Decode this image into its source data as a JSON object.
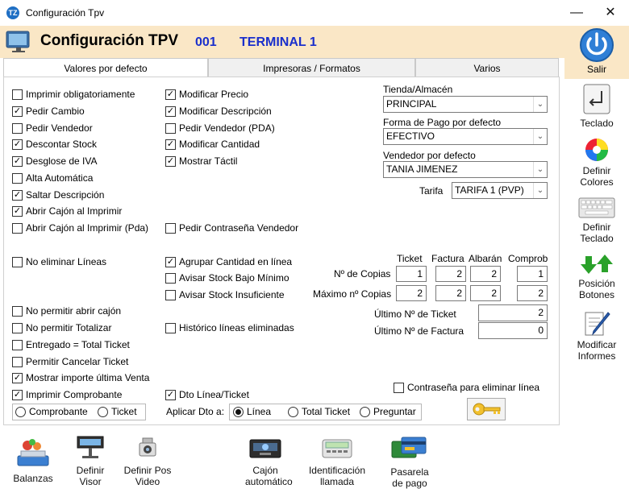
{
  "window": {
    "title": "Configuración Tpv",
    "app_icon_text": "TZ",
    "minimize": "—",
    "close": "✕"
  },
  "header": {
    "title": "Configuración TPV",
    "number": "001",
    "terminal": "TERMINAL 1"
  },
  "tabs": [
    {
      "label": "Valores por defecto",
      "active": true
    },
    {
      "label": "Impresoras / Formatos",
      "active": false
    },
    {
      "label": "Varios",
      "active": false
    }
  ],
  "checkboxes_col1": [
    {
      "label": "Imprimir obligatoriamente",
      "checked": false
    },
    {
      "label": "Pedir Cambio",
      "checked": true
    },
    {
      "label": "Pedir Vendedor",
      "checked": false
    },
    {
      "label": "Descontar Stock",
      "checked": true
    },
    {
      "label": "Desglose de IVA",
      "checked": true
    },
    {
      "label": "Alta Automática",
      "checked": false
    },
    {
      "label": "Saltar Descripción",
      "checked": true
    },
    {
      "label": "Abrir Cajón al Imprimir",
      "checked": true
    },
    {
      "label": "Abrir Cajón al Imprimir (Pda)",
      "checked": false
    },
    {
      "label": "No eliminar Líneas",
      "checked": false
    },
    {
      "label": "No permitir abrir cajón",
      "checked": false
    },
    {
      "label": "No permitir Totalizar",
      "checked": false
    },
    {
      "label": "Entregado = Total Ticket",
      "checked": false
    },
    {
      "label": "Permitir Cancelar Ticket",
      "checked": false
    },
    {
      "label": "Mostrar importe última Venta",
      "checked": true
    },
    {
      "label": "Imprimir Comprobante",
      "checked": true
    }
  ],
  "checkboxes_col2": [
    {
      "label": "Modificar Precio",
      "checked": true
    },
    {
      "label": "Modificar Descripción",
      "checked": true
    },
    {
      "label": "Pedir Vendedor (PDA)",
      "checked": false
    },
    {
      "label": "Modificar Cantidad",
      "checked": true
    },
    {
      "label": "Mostrar Táctil",
      "checked": true
    },
    {
      "label": "Pedir Contraseña Vendedor",
      "checked": false
    },
    {
      "label": "Agrupar Cantidad en línea",
      "checked": true
    },
    {
      "label": "Avisar Stock Bajo Mínimo",
      "checked": false
    },
    {
      "label": "Avisar Stock Insuficiente",
      "checked": false
    },
    {
      "label": "Histórico líneas eliminadas",
      "checked": false
    },
    {
      "label": "Dto Línea/Ticket",
      "checked": true
    }
  ],
  "comprobante_radios": [
    {
      "label": "Comprobante",
      "selected": false
    },
    {
      "label": "Ticket",
      "selected": false
    }
  ],
  "aplicar_dto": {
    "label": "Aplicar Dto a:",
    "options": [
      {
        "label": "Línea",
        "selected": true
      },
      {
        "label": "Total Ticket",
        "selected": false
      },
      {
        "label": "Preguntar",
        "selected": false
      }
    ]
  },
  "tienda": {
    "label": "Tienda/Almacén",
    "value": "PRINCIPAL"
  },
  "forma_pago": {
    "label": "Forma de Pago por defecto",
    "value": "EFECTIVO"
  },
  "vendedor": {
    "label": "Vendedor por defecto",
    "value": "TANIA JIMENEZ"
  },
  "tarifa": {
    "label": "Tarifa",
    "value": "TARIFA 1 (PVP)"
  },
  "copias": {
    "headers": [
      "Ticket",
      "Factura",
      "Albarán",
      "Comprob"
    ],
    "rows": [
      {
        "label": "Nº de Copias",
        "values": [
          "1",
          "2",
          "2",
          "1"
        ]
      },
      {
        "label": "Máximo nº Copias",
        "values": [
          "2",
          "2",
          "2",
          "2"
        ]
      }
    ]
  },
  "ultimo_ticket": {
    "label": "Último Nº de Ticket",
    "value": "2"
  },
  "ultimo_factura": {
    "label": "Último Nº de Factura",
    "value": "0"
  },
  "contrasena_eliminar": {
    "label": "Contraseña para eliminar línea",
    "checked": false
  },
  "right_buttons": [
    {
      "label": "Salir"
    },
    {
      "label": "Teclado"
    },
    {
      "label": "Definir Colores"
    },
    {
      "label": "Definir Teclado"
    },
    {
      "label": "Posición Botones"
    },
    {
      "label": "Modificar Informes"
    }
  ],
  "footer_buttons": [
    {
      "label": "Balanzas"
    },
    {
      "label": "Definir Visor"
    },
    {
      "label": "Definir Pos Video"
    },
    {
      "label": "Cajón automático"
    },
    {
      "label": "Identificación llamada"
    },
    {
      "label": "Pasarela de pago"
    }
  ],
  "colors": {
    "header_bg": "#fae7c6",
    "accent_blue": "#1a2fcc"
  }
}
